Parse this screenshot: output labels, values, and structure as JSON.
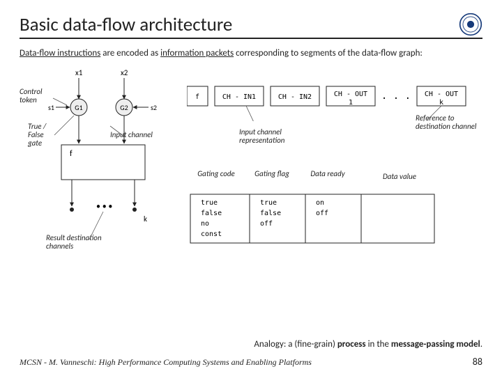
{
  "title": "Basic data-flow architecture",
  "intro_a": "Data-flow instructions",
  "intro_b": " are encoded as ",
  "intro_c": "information packets",
  "intro_d": " corresponding to segments of the data-flow graph:",
  "labels": {
    "control_token": "Control token",
    "tf_gate": "True / False gate",
    "input_channel": "Input channel",
    "input_channel_repr": "Input channel representation",
    "ref_dest": "Reference to destination channel",
    "gating_code": "Gating code",
    "gating_flag": "Gating flag",
    "data_ready": "Data ready",
    "data_value": "Data value",
    "result_dest": "Result destination channels"
  },
  "graph": {
    "x1": "x1",
    "x2": "x2",
    "s1": "s1",
    "s2": "s2",
    "g1": "G1",
    "g2": "G2",
    "f": "f",
    "k": "k"
  },
  "packet": {
    "f": "f",
    "ch_in1": "CH - IN1",
    "ch_in2": "CH - IN2",
    "ch_out1": "CH - OUT",
    "one": "1",
    "dots": ". . .",
    "ch_outk": "CH - OUT",
    "kk": "k"
  },
  "table": {
    "c0": [
      "true",
      "false",
      "no",
      "const"
    ],
    "c1": [
      "true",
      "false",
      "off"
    ],
    "c2": [
      "on",
      "off"
    ]
  },
  "analogy_a": "Analogy: a (fine-grain) ",
  "analogy_b": "process",
  "analogy_c": " in the ",
  "analogy_d": "message-passing model",
  "analogy_e": ".",
  "footer": {
    "left": "MCSN  -   M. Vanneschi: High Performance Computing Systems and Enabling Platforms",
    "page": "88"
  }
}
